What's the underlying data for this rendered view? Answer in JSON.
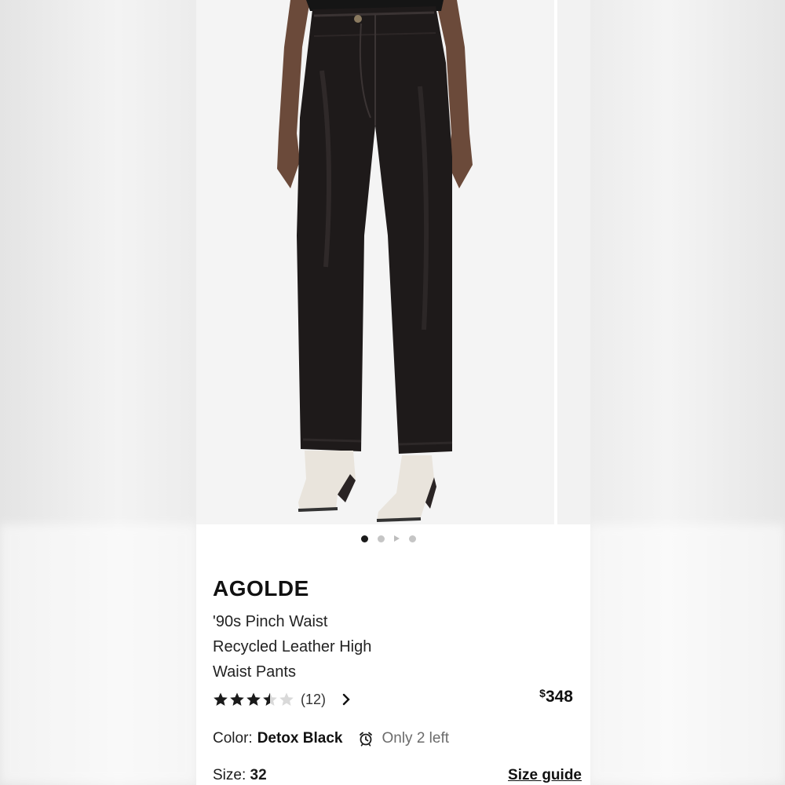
{
  "carousel": {
    "total_slides": 4,
    "active_index": 0
  },
  "product": {
    "brand": "AGOLDE",
    "title_lines": [
      "'90s Pinch Waist",
      "Recycled Leather High",
      "Waist Pants"
    ],
    "rating": 3.5,
    "rating_max": 5,
    "review_count": "(12)",
    "price_currency": "$",
    "price_amount": "348"
  },
  "color": {
    "label": "Color:",
    "value": "Detox Black",
    "stock_text": "Only 2 left"
  },
  "size": {
    "label": "Size:",
    "value": "32",
    "guide_label": "Size guide"
  },
  "colors": {
    "star_filled": "#1a1a1a",
    "star_empty": "#d9d9d9",
    "pants": "#1e1a1a",
    "boots": "#e9e4dc"
  },
  "icons": {
    "rating": "star-icon",
    "chevron": "chevron-right-icon",
    "stock": "alarm-clock-icon"
  }
}
